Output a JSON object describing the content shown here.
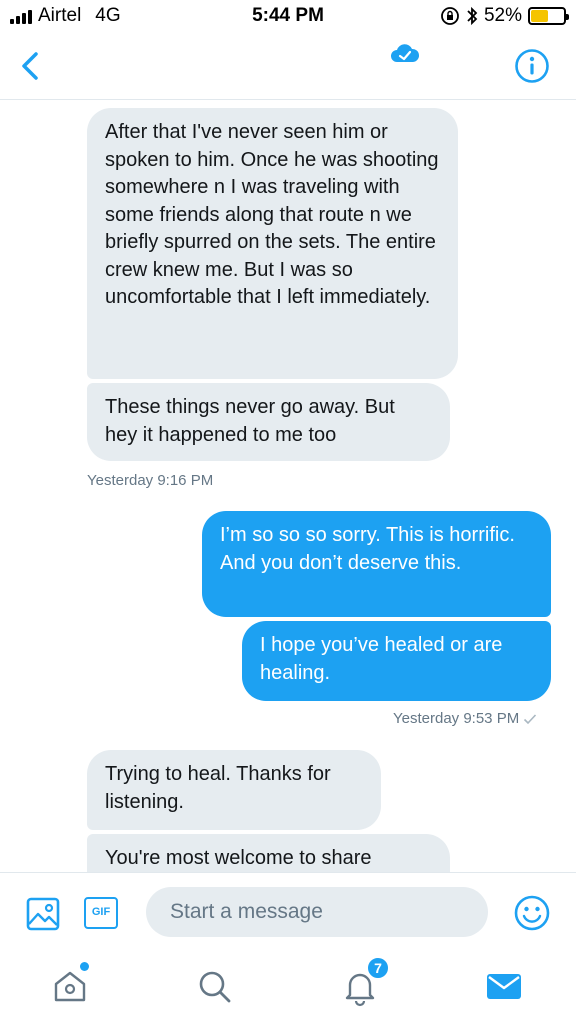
{
  "status_bar": {
    "carrier": "Airtel",
    "network": "4G",
    "time": "5:44 PM",
    "battery_percent": "52%",
    "battery_level": 0.52,
    "icons": [
      "signal-icon",
      "orientation-lock-icon",
      "bluetooth-icon",
      "battery-icon"
    ]
  },
  "header": {
    "back_icon": "chevron-left-icon",
    "center_icon": "cloud-verified-icon",
    "info_icon": "info-icon"
  },
  "messages": [
    {
      "direction": "in",
      "text": "After that I've never seen him or spoken to him. Once he was shooting somewhere n I was traveling with some friends along that route n we briefly spurred on the sets. The entire crew knew me. But I was so uncomfortable that I left immediately."
    },
    {
      "direction": "in",
      "text": "These things never go away. But hey it happened to me too"
    },
    {
      "direction": "out",
      "text": "I’m so so so sorry. This is horrific. And you don’t deserve this."
    },
    {
      "direction": "out",
      "text": "I hope you’ve healed or are healing."
    },
    {
      "direction": "in",
      "text": "Trying to heal. Thanks for listening."
    },
    {
      "direction": "in",
      "text": "You're most welcome to share"
    }
  ],
  "timestamps": {
    "first": "Yesterday 9:16 PM",
    "second": "Yesterday 9:53 PM"
  },
  "composer": {
    "placeholder": "Start a message",
    "gif_label": "GIF"
  },
  "tabbar": {
    "notifications_count": "7"
  },
  "colors": {
    "accent": "#1da1f2",
    "incoming_bubble": "#e6ecf0",
    "secondary_text": "#657786"
  }
}
